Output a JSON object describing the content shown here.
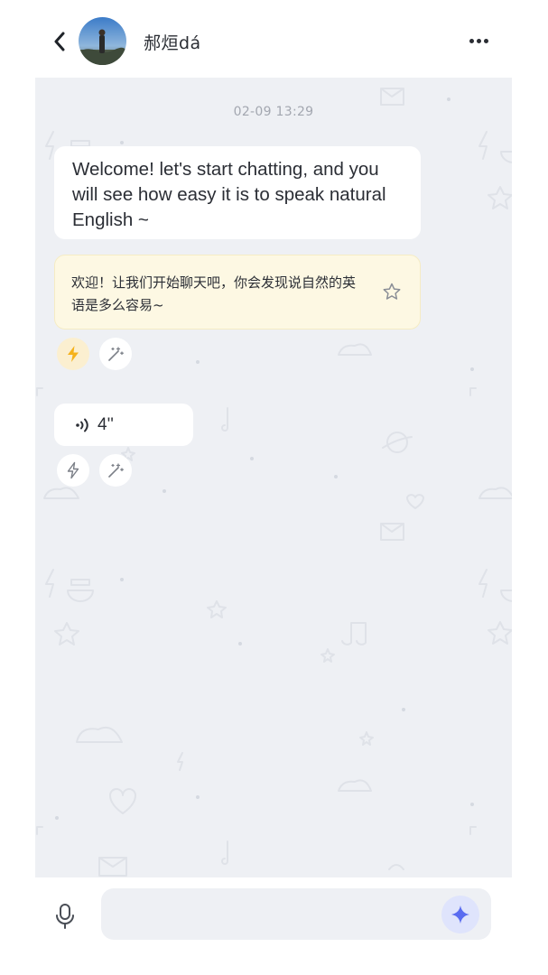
{
  "header": {
    "contact_name": "郝烜dá",
    "icons": [
      "chevron-left-icon",
      "avatar",
      "more-dots-icon"
    ]
  },
  "chat": {
    "timestamp": "02-09 13:29",
    "messages": [
      {
        "type": "text",
        "text": "Welcome! let's start chatting, and you will see how easy it is to speak natural English ~"
      },
      {
        "type": "translation",
        "text": "欢迎！让我们开始聊天吧，你会发现说自然的英语是多么容易~"
      },
      {
        "type": "voice",
        "duration": "4''"
      }
    ],
    "actions": [
      "lightning-icon",
      "magic-wand-icon"
    ]
  },
  "input": {
    "placeholder": "",
    "value": ""
  },
  "colors": {
    "chat_background": "#eef0f4",
    "translation_bubble": "#fdf8e3",
    "accent_lightning": "#f5b21b",
    "accent_spark": "#5a6cf0"
  }
}
